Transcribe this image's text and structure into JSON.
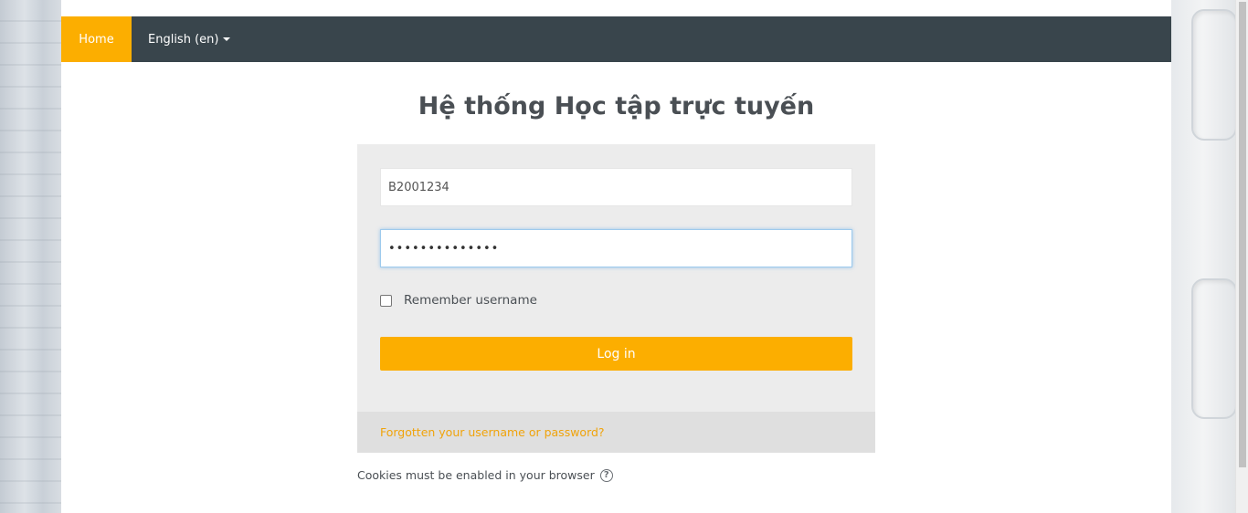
{
  "navbar": {
    "home_label": "Home",
    "language_label": "English (en)"
  },
  "page_title": "Hệ thống Học tập trực tuyến",
  "login_form": {
    "username_value": "B2001234",
    "password_value": "••••••••••••••",
    "remember_label": "Remember username",
    "remember_checked": false,
    "login_button_label": "Log in",
    "forgot_link": "Forgotten your username or password?"
  },
  "cookies_notice": "Cookies must be enabled in your browser",
  "colors": {
    "accent": "#fcae00",
    "navbar": "#39454c",
    "card": "#ececec",
    "link": "#f0a30a"
  }
}
